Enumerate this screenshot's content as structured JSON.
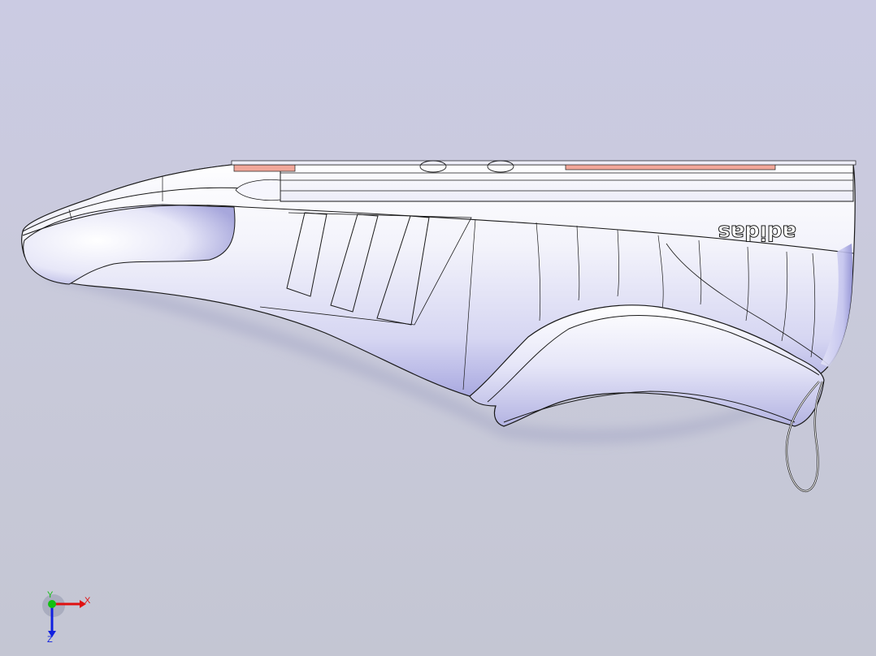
{
  "viewport": {
    "background_top": "#cbcbe3",
    "background_bottom": "#c4c6d3"
  },
  "model": {
    "brand_text": "adidas",
    "body_color": "#f4f4fc",
    "shade_color": "#9a9ad8",
    "edge_color": "#1a1a1a",
    "accent_color": "#f1a79a"
  },
  "triad": {
    "x_label": "X",
    "y_label": "Y",
    "z_label": "Z",
    "x_color": "#e01010",
    "y_color": "#10c010",
    "z_color": "#1020e0"
  }
}
